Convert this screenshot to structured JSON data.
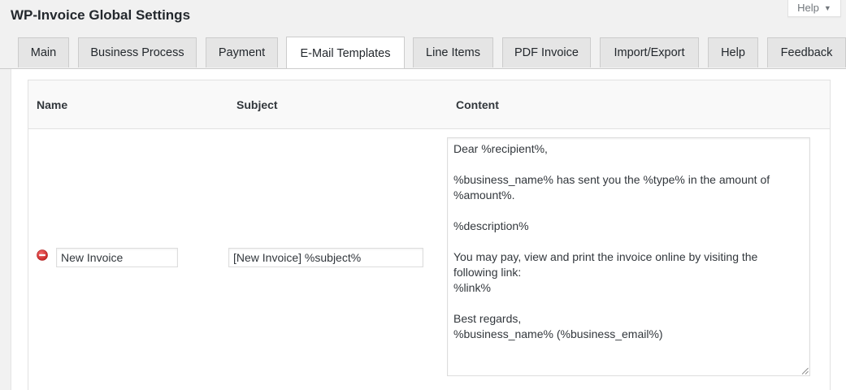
{
  "header": {
    "title": "WP-Invoice Global Settings",
    "help_label": "Help",
    "help_caret_icon": "caret-down-icon"
  },
  "tabs": [
    {
      "label": "Main",
      "active": false
    },
    {
      "label": "Business Process",
      "active": false
    },
    {
      "label": "Payment",
      "active": false
    },
    {
      "label": "E-Mail Templates",
      "active": true
    },
    {
      "label": "Line Items",
      "active": false
    },
    {
      "label": "PDF Invoice",
      "active": false
    },
    {
      "label": "Import/Export",
      "active": false
    },
    {
      "label": "Help",
      "active": false
    },
    {
      "label": "Feedback",
      "active": false
    }
  ],
  "table": {
    "columns": {
      "name": "Name",
      "subject": "Subject",
      "content": "Content"
    },
    "row": {
      "remove_icon": "remove-minus-circle-icon",
      "name_value": "New Invoice",
      "subject_value": "[New Invoice] %subject%",
      "content_lines": [
        "Dear %recipient%,",
        "",
        "%business_name% has sent you the %type% in the amount of",
        "%amount%.",
        "",
        "%description%",
        "",
        "You may pay, view and print the invoice online by visiting the",
        "following link:",
        "%link%",
        "",
        "Best regards,",
        "%business_name% (%business_email%)"
      ]
    }
  },
  "colors": {
    "active_tab_bg": "#ffffff",
    "inactive_tab_bg": "#e5e5e5",
    "remove_icon": "#dc3232"
  }
}
